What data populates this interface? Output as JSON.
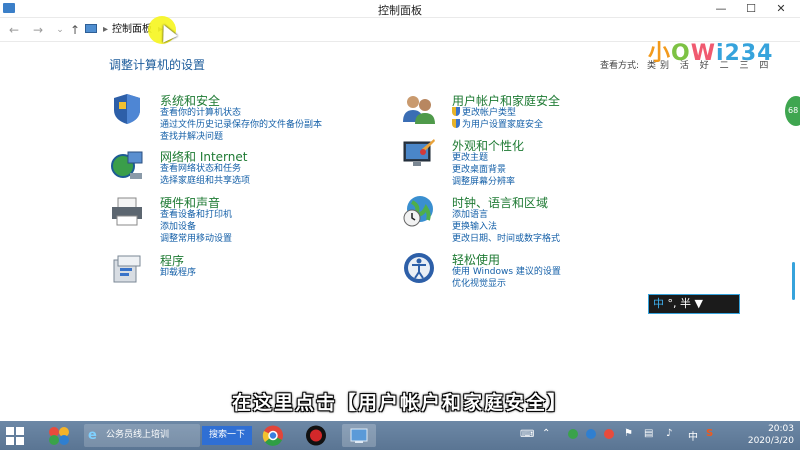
{
  "window": {
    "title": "控制面板",
    "minimize_icon": "minimize-icon",
    "maximize_icon": "maximize-icon",
    "close_icon": "close-icon"
  },
  "address": {
    "root_label": "控制面板",
    "separator": "▸"
  },
  "logo": {
    "part1": "小",
    "part2": "O",
    "part3": "W",
    "part4": "i234"
  },
  "heading": "调整计算机的设置",
  "view_by": {
    "label": "查看方式:",
    "values": "类别 活 好 二 三 四"
  },
  "categories": [
    {
      "title": "系统和安全",
      "icon": "shield-flag-icon",
      "links": [
        "查看你的计算机状态",
        "通过文件历史记录保存你的文件备份副本",
        "查找并解决问题"
      ]
    },
    {
      "title": "网络和 Internet",
      "icon": "network-globe-icon",
      "links": [
        "查看网络状态和任务",
        "选择家庭组和共享选项"
      ]
    },
    {
      "title": "硬件和声音",
      "icon": "printer-icon",
      "links": [
        "查看设备和打印机",
        "添加设备",
        "调整常用移动设置"
      ]
    },
    {
      "title": "程序",
      "icon": "programs-icon",
      "links": [
        "卸载程序"
      ]
    },
    {
      "title": "用户帐户和家庭安全",
      "icon": "users-icon",
      "links": [
        "更改帐户类型",
        "为用户设置家庭安全"
      ]
    },
    {
      "title": "外观和个性化",
      "icon": "monitor-paint-icon",
      "links": [
        "更改主题",
        "更改桌面背景",
        "调整屏幕分辨率"
      ]
    },
    {
      "title": "时钟、语言和区域",
      "icon": "clock-globe-icon",
      "links": [
        "添加语言",
        "更换输入法",
        "更改日期、时间或数字格式"
      ]
    },
    {
      "title": "轻松使用",
      "icon": "ease-of-access-icon",
      "links": [
        "使用 Windows 建议的设置",
        "优化视觉显示"
      ]
    }
  ],
  "ime": {
    "lang": "中",
    "rest": "°, 半"
  },
  "side_badge": "68",
  "subtitle": "在这里点击【用户帐户和家庭安全】",
  "taskbar": {
    "task_label": "公务员线上培训",
    "search_label": "搜索一下",
    "tray_lang": "中",
    "time": "20:03",
    "date": "2020/3/20"
  },
  "colors": {
    "link": "#1560a8",
    "category_title": "#1e7a33",
    "taskbar": "#5a7593",
    "accent": "#36a3dc"
  }
}
